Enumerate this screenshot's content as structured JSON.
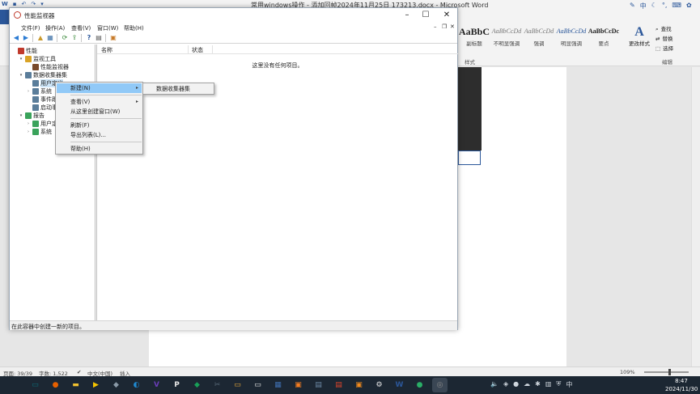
{
  "word": {
    "title": "常用windows操作 - 添加回帧2024年11月25日 173213.docx - Microsoft Word",
    "styles": [
      {
        "sample": "AaBbC",
        "name": "副标题",
        "cls": "big"
      },
      {
        "sample": "AaBbCcDd",
        "name": "不明显强调",
        "cls": "italic"
      },
      {
        "sample": "AaBbCcDd",
        "name": "强调",
        "cls": "italic"
      },
      {
        "sample": "AaBbCcDd",
        "name": "明显强调",
        "cls": "italic2"
      },
      {
        "sample": "AaBbCcDc",
        "name": "要点",
        "cls": "bold2"
      }
    ],
    "styles_group_label": "样式",
    "change_style_label": "更改样式",
    "edit_group_label": "编辑",
    "edit_find": "查找",
    "edit_replace": "替换",
    "edit_select": "选择",
    "status": {
      "page": "页面: 39/39",
      "words": "字数: 1,522",
      "lang": "中文(中国)",
      "insert": "插入",
      "zoom": "109%"
    }
  },
  "taskbar": {
    "icons": [
      {
        "name": "terminal-icon",
        "color": "#0b6e7a",
        "glyph": "▭"
      },
      {
        "name": "firefox-icon",
        "color": "#e66000",
        "glyph": "●"
      },
      {
        "name": "explorer-icon",
        "color": "#f2c230",
        "glyph": "▬"
      },
      {
        "name": "player-icon",
        "color": "#f5c400",
        "glyph": "▶"
      },
      {
        "name": "app-icon",
        "color": "#8a9aa8",
        "glyph": "◆"
      },
      {
        "name": "edge-icon",
        "color": "#1f8ad2",
        "glyph": "◐"
      },
      {
        "name": "visual-studio-icon",
        "color": "#6a3db8",
        "glyph": "V"
      },
      {
        "name": "pycharm-icon",
        "color": "#1d1d1d",
        "glyph": "P"
      },
      {
        "name": "diamond-icon",
        "color": "#18a058",
        "glyph": "◆"
      },
      {
        "name": "tools-icon",
        "color": "#5a6b7a",
        "glyph": "✂"
      },
      {
        "name": "folder-icon",
        "color": "#e8a93a",
        "glyph": "▭"
      },
      {
        "name": "cmd-icon",
        "color": "#000000",
        "glyph": "▭"
      },
      {
        "name": "network-icon",
        "color": "#3f6fb0",
        "glyph": "▦"
      },
      {
        "name": "orange-app-icon",
        "color": "#f47c20",
        "glyph": "▣"
      },
      {
        "name": "notepad-icon",
        "color": "#6d8aa6",
        "glyph": "▤"
      },
      {
        "name": "red-app-icon",
        "color": "#e0452b",
        "glyph": "▤"
      },
      {
        "name": "orange2-app-icon",
        "color": "#f08a1d",
        "glyph": "▣"
      },
      {
        "name": "settings-icon",
        "color": "#1c2733",
        "glyph": "⚙"
      },
      {
        "name": "word-icon",
        "color": "#2b579a",
        "glyph": "W"
      },
      {
        "name": "wechat-icon",
        "color": "#2aae67",
        "glyph": "●"
      },
      {
        "name": "perfmon-icon",
        "color": "#8a8a8a",
        "glyph": "◎"
      }
    ],
    "time": "8:47",
    "date": "2024/11/30"
  },
  "perfmon": {
    "title": "性能监视器",
    "menu": [
      "文件(F)",
      "操作(A)",
      "查看(V)",
      "窗口(W)",
      "帮助(H)"
    ],
    "tree": [
      {
        "label": "性能",
        "level": 0,
        "twisty": "",
        "color": "#c0392b"
      },
      {
        "label": "监视工具",
        "level": 1,
        "twisty": "▾",
        "color": "#d9a326"
      },
      {
        "label": "性能监视器",
        "level": 2,
        "twisty": "",
        "color": "#7a4a2a"
      },
      {
        "label": "数据收集器集",
        "level": 1,
        "twisty": "▾",
        "color": "#5a7d9a"
      },
      {
        "label": "用户定义",
        "level": 2,
        "twisty": "",
        "color": "#5a7d9a",
        "selected": true
      },
      {
        "label": "系统",
        "level": 2,
        "twisty": "›",
        "color": "#5a7d9a"
      },
      {
        "label": "事件跟",
        "level": 2,
        "twisty": "",
        "color": "#5a7d9a"
      },
      {
        "label": "启动事",
        "level": 2,
        "twisty": "",
        "color": "#5a7d9a"
      },
      {
        "label": "报告",
        "level": 1,
        "twisty": "▾",
        "color": "#3aa35b"
      },
      {
        "label": "用户定",
        "level": 2,
        "twisty": "›",
        "color": "#3aa35b"
      },
      {
        "label": "系统",
        "level": 2,
        "twisty": "›",
        "color": "#3aa35b"
      }
    ],
    "columns": [
      "名称",
      "状态"
    ],
    "empty_message": "这里没有任何项目。",
    "status": "在此容器中创建一新的项目。"
  },
  "context_menu": {
    "items": [
      {
        "label": "新建(N)",
        "highlight": true,
        "submenu": true
      },
      {
        "sep": true
      },
      {
        "label": "查看(V)",
        "submenu": true
      },
      {
        "label": "从这里创建窗口(W)"
      },
      {
        "sep": true
      },
      {
        "label": "刷新(F)"
      },
      {
        "label": "导出列表(L)..."
      },
      {
        "sep": true
      },
      {
        "label": "帮助(H)"
      }
    ],
    "submenu_item": "数据收集器集"
  },
  "colors": {
    "accent": "#2b579a",
    "highlight": "#91c9f7",
    "taskbar": "#1c2733"
  }
}
